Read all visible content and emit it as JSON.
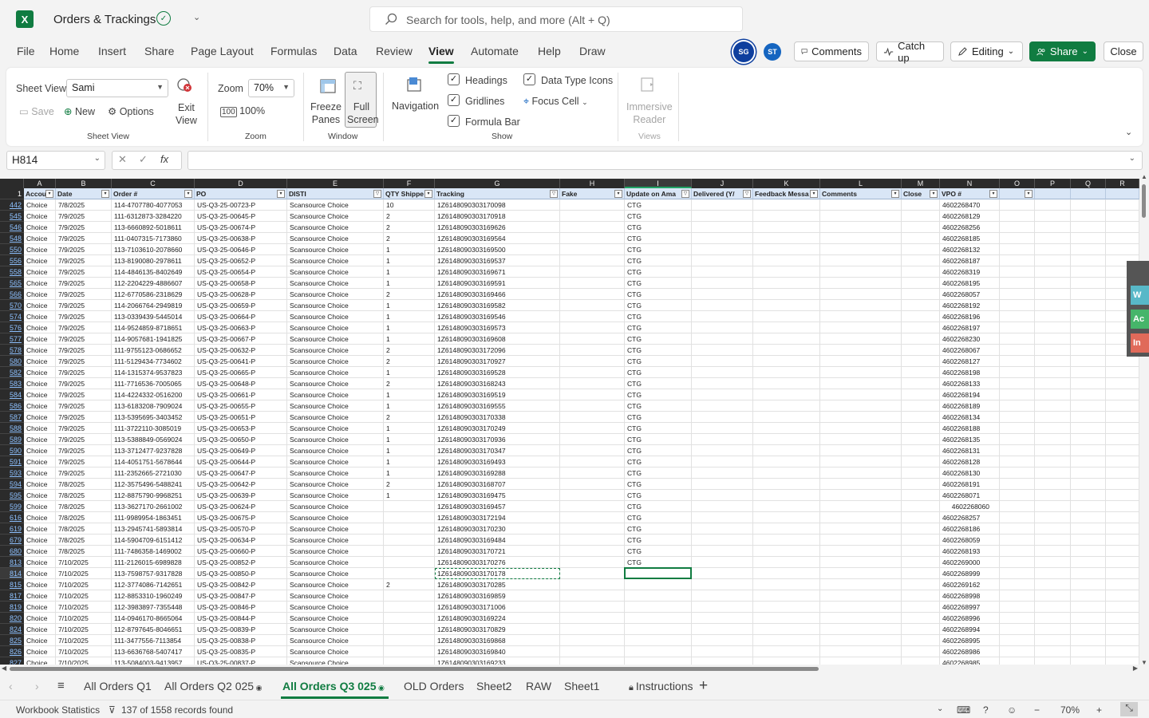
{
  "app": {
    "doc_title": "Orders & Trackings",
    "search_placeholder": "Search for tools, help, and more (Alt + Q)"
  },
  "menu": [
    "File",
    "Home",
    "Insert",
    "Share",
    "Page Layout",
    "Formulas",
    "Data",
    "Review",
    "View",
    "Automate",
    "Help",
    "Draw"
  ],
  "menu_active": "View",
  "users": {
    "sg": "SG",
    "st": "ST"
  },
  "top_buttons": {
    "comments": "Comments",
    "catchup": "Catch up",
    "editing": "Editing",
    "share": "Share",
    "close": "Close"
  },
  "ribbon": {
    "sheet_view_label": "Sheet View",
    "sheet_view_value": "Sami",
    "save": "Save",
    "new": "New",
    "options": "Options",
    "exit_view": "Exit\nView",
    "group_sheet_view": "Sheet View",
    "zoom_label": "Zoom",
    "zoom_value": "70%",
    "zoom_100": "100%",
    "group_zoom": "Zoom",
    "freeze_panes": "Freeze\nPanes",
    "full_screen": "Full\nScreen",
    "group_window": "Window",
    "navigation": "Navigation",
    "headings": "Headings",
    "gridlines": "Gridlines",
    "formula_bar": "Formula Bar",
    "data_type_icons": "Data Type Icons",
    "focus_cell": "Focus Cell",
    "group_show": "Show",
    "immersive_reader": "Immersive\nReader",
    "group_views": "Views"
  },
  "formula_bar": {
    "name_box": "H814",
    "value": ""
  },
  "columns": [
    {
      "letter": "A",
      "header": "Accou",
      "filter": false
    },
    {
      "letter": "B",
      "header": "Date",
      "filter": false
    },
    {
      "letter": "C",
      "header": "Order #",
      "filter": false
    },
    {
      "letter": "D",
      "header": "PO",
      "filter": false
    },
    {
      "letter": "E",
      "header": "DISTI",
      "filter": true
    },
    {
      "letter": "F",
      "header": "QTY Shippe",
      "filter": false
    },
    {
      "letter": "G",
      "header": "Tracking",
      "filter": true
    },
    {
      "letter": "H",
      "header": "Fake",
      "filter": false
    },
    {
      "letter": "I",
      "header": "Update on Ama",
      "filter": true
    },
    {
      "letter": "J",
      "header": "Delivered (Y/",
      "filter": true
    },
    {
      "letter": "K",
      "header": "Feedback Messa",
      "filter": false
    },
    {
      "letter": "L",
      "header": "Comments",
      "filter": false
    },
    {
      "letter": "M",
      "header": "Close",
      "filter": false
    },
    {
      "letter": "N",
      "header": "VPO #",
      "filter": false
    },
    {
      "letter": "O",
      "header": "",
      "filter": false
    },
    {
      "letter": "P",
      "header": "",
      "filter": false
    },
    {
      "letter": "Q",
      "header": "",
      "filter": false
    },
    {
      "letter": "R",
      "header": "",
      "filter": false
    }
  ],
  "header_row_number": "1",
  "rows": [
    [
      "442",
      "Choice",
      "7/8/2025",
      "114-4707780-4077053",
      "US-Q3-25-00723-P",
      "Scansource Choice",
      "10",
      "1Z6148090303170098",
      "",
      "CTG",
      "4602268470"
    ],
    [
      "545",
      "Choice",
      "7/9/2025",
      "111-6312873-3284220",
      "US-Q3-25-00645-P",
      "Scansource Choice",
      "2",
      "1Z6148090303170918",
      "",
      "CTG",
      "4602268129"
    ],
    [
      "546",
      "Choice",
      "7/9/2025",
      "113-6660892-5018611",
      "US-Q3-25-00674-P",
      "Scansource Choice",
      "2",
      "1Z6148090303169626",
      "",
      "CTG",
      "4602268256"
    ],
    [
      "548",
      "Choice",
      "7/9/2025",
      "111-0407315-7173860",
      "US-Q3-25-00638-P",
      "Scansource Choice",
      "2",
      "1Z6148090303169564",
      "",
      "CTG",
      "4602268185"
    ],
    [
      "550",
      "Choice",
      "7/9/2025",
      "113-7103610-2078660",
      "US-Q3-25-00646-P",
      "Scansource Choice",
      "1",
      "1Z6148090303169500",
      "",
      "CTG",
      "4602268132"
    ],
    [
      "556",
      "Choice",
      "7/9/2025",
      "113-8190080-2978611",
      "US-Q3-25-00652-P",
      "Scansource Choice",
      "1",
      "1Z6148090303169537",
      "",
      "CTG",
      "4602268187"
    ],
    [
      "558",
      "Choice",
      "7/9/2025",
      "114-4846135-8402649",
      "US-Q3-25-00654-P",
      "Scansource Choice",
      "1",
      "1Z6148090303169671",
      "",
      "CTG",
      "4602268319"
    ],
    [
      "565",
      "Choice",
      "7/9/2025",
      "112-2204229-4886607",
      "US-Q3-25-00658-P",
      "Scansource Choice",
      "1",
      "1Z6148090303169591",
      "",
      "CTG",
      "4602268195"
    ],
    [
      "566",
      "Choice",
      "7/9/2025",
      "112-6770586-2318629",
      "US-Q3-25-00628-P",
      "Scansource Choice",
      "2",
      "1Z6148090303169466",
      "",
      "CTG",
      "4602268057"
    ],
    [
      "570",
      "Choice",
      "7/9/2025",
      "114-2066764-2949819",
      "US-Q3-25-00659-P",
      "Scansource Choice",
      "1",
      "1Z6148090303169582",
      "",
      "CTG",
      "4602268192"
    ],
    [
      "574",
      "Choice",
      "7/9/2025",
      "113-0339439-5445014",
      "US-Q3-25-00664-P",
      "Scansource Choice",
      "1",
      "1Z6148090303169546",
      "",
      "CTG",
      "4602268196"
    ],
    [
      "576",
      "Choice",
      "7/9/2025",
      "114-9524859-8718651",
      "US-Q3-25-00663-P",
      "Scansource Choice",
      "1",
      "1Z6148090303169573",
      "",
      "CTG",
      "4602268197"
    ],
    [
      "577",
      "Choice",
      "7/9/2025",
      "114-9057681-1941825",
      "US-Q3-25-00667-P",
      "Scansource Choice",
      "1",
      "1Z6148090303169608",
      "",
      "CTG",
      "4602268230"
    ],
    [
      "578",
      "Choice",
      "7/9/2025",
      "111-9755123-0686652",
      "US-Q3-25-00632-P",
      "Scansource Choice",
      "2",
      "1Z6148090303172096",
      "",
      "CTG",
      "4602268067"
    ],
    [
      "580",
      "Choice",
      "7/9/2025",
      "111-5129434-7734602",
      "US-Q3-25-00641-P",
      "Scansource Choice",
      "2",
      "1Z6148090303170927",
      "",
      "CTG",
      "4602268127"
    ],
    [
      "582",
      "Choice",
      "7/9/2025",
      "114-1315374-9537823",
      "US-Q3-25-00665-P",
      "Scansource Choice",
      "1",
      "1Z6148090303169528",
      "",
      "CTG",
      "4602268198"
    ],
    [
      "583",
      "Choice",
      "7/9/2025",
      "111-7716536-7005065",
      "US-Q3-25-00648-P",
      "Scansource Choice",
      "2",
      "1Z6148090303168243",
      "",
      "CTG",
      "4602268133"
    ],
    [
      "584",
      "Choice",
      "7/9/2025",
      "114-4224332-0516200",
      "US-Q3-25-00661-P",
      "Scansource Choice",
      "1",
      "1Z6148090303169519",
      "",
      "CTG",
      "4602268194"
    ],
    [
      "586",
      "Choice",
      "7/9/2025",
      "113-6183208-7909024",
      "US-Q3-25-00655-P",
      "Scansource Choice",
      "1",
      "1Z6148090303169555",
      "",
      "CTG",
      "4602268189"
    ],
    [
      "587",
      "Choice",
      "7/9/2025",
      "113-5395695-3403452",
      "US-Q3-25-00651-P",
      "Scansource Choice",
      "2",
      "1Z6148090303170338",
      "",
      "CTG",
      "4602268134"
    ],
    [
      "588",
      "Choice",
      "7/9/2025",
      "111-3722110-3085019",
      "US-Q3-25-00653-P",
      "Scansource Choice",
      "1",
      "1Z6148090303170249",
      "",
      "CTG",
      "4602268188"
    ],
    [
      "589",
      "Choice",
      "7/9/2025",
      "113-5388849-0569024",
      "US-Q3-25-00650-P",
      "Scansource Choice",
      "1",
      "1Z6148090303170936",
      "",
      "CTG",
      "4602268135"
    ],
    [
      "590",
      "Choice",
      "7/9/2025",
      "113-3712477-9237828",
      "US-Q3-25-00649-P",
      "Scansource Choice",
      "1",
      "1Z6148090303170347",
      "",
      "CTG",
      "4602268131"
    ],
    [
      "591",
      "Choice",
      "7/9/2025",
      "114-4051751-5678644",
      "US-Q3-25-00644-P",
      "Scansource Choice",
      "1",
      "1Z6148090303169493",
      "",
      "CTG",
      "4602268128"
    ],
    [
      "593",
      "Choice",
      "7/9/2025",
      "111-2352665-2721030",
      "US-Q3-25-00647-P",
      "Scansource Choice",
      "1",
      "1Z6148090303169288",
      "",
      "CTG",
      "4602268130"
    ],
    [
      "594",
      "Choice",
      "7/8/2025",
      "112-3575496-5488241",
      "US-Q3-25-00642-P",
      "Scansource Choice",
      "2",
      "1Z6148090303168707",
      "",
      "CTG",
      "4602268191"
    ],
    [
      "595",
      "Choice",
      "7/8/2025",
      "112-8875790-9968251",
      "US-Q3-25-00639-P",
      "Scansource Choice",
      "1",
      "1Z6148090303169475",
      "",
      "CTG",
      "4602268071"
    ],
    [
      "599",
      "Choice",
      "7/8/2025",
      "113-3627170-2661002",
      "US-Q3-25-00624-P",
      "Scansource Choice",
      "",
      "1Z6148090303169457",
      "",
      "CTG",
      "4602268060"
    ],
    [
      "616",
      "Choice",
      "7/8/2025",
      "111-9989954-1863451",
      "US-Q3-25-00675-P",
      "Scansource Choice",
      "",
      "1Z6148090303172194",
      "",
      "CTG",
      "4602268257"
    ],
    [
      "619",
      "Choice",
      "7/8/2025",
      "113-2945741-5893814",
      "US-Q3-25-00570-P",
      "Scansource Choice",
      "",
      "1Z6148090303170230",
      "",
      "CTG",
      "4602268186"
    ],
    [
      "679",
      "Choice",
      "7/8/2025",
      "114-5904709-6151412",
      "US-Q3-25-00634-P",
      "Scansource Choice",
      "",
      "1Z6148090303169484",
      "",
      "CTG",
      "4602268059"
    ],
    [
      "680",
      "Choice",
      "7/8/2025",
      "111-7486358-1469002",
      "US-Q3-25-00660-P",
      "Scansource Choice",
      "",
      "1Z6148090303170721",
      "",
      "CTG",
      "4602268193"
    ],
    [
      "813",
      "Choice",
      "7/10/2025",
      "111-2126015-6989828",
      "US-Q3-25-00852-P",
      "Scansource Choice",
      "",
      "1Z6148090303170276",
      "",
      "CTG",
      "4602269000"
    ],
    [
      "814",
      "Choice",
      "7/10/2025",
      "113-7598757-9317828",
      "US-Q3-25-00850-P",
      "Scansource Choice",
      "",
      "1Z6148090303170178",
      "",
      "",
      "4602268999"
    ],
    [
      "815",
      "Choice",
      "7/10/2025",
      "112-3774086-7142651",
      "US-Q3-25-00842-P",
      "Scansource Choice",
      "2",
      "1Z6148090303170285",
      "",
      "",
      "4602269162"
    ],
    [
      "817",
      "Choice",
      "7/10/2025",
      "112-8853310-1960249",
      "US-Q3-25-00847-P",
      "Scansource Choice",
      "",
      "1Z6148090303169859",
      "",
      "",
      "4602268998"
    ],
    [
      "819",
      "Choice",
      "7/10/2025",
      "112-3983897-7355448",
      "US-Q3-25-00846-P",
      "Scansource Choice",
      "",
      "1Z6148090303171006",
      "",
      "",
      "4602268997"
    ],
    [
      "820",
      "Choice",
      "7/10/2025",
      "114-0946170-8665064",
      "US-Q3-25-00844-P",
      "Scansource Choice",
      "",
      "1Z6148090303169224",
      "",
      "",
      "4602268996"
    ],
    [
      "824",
      "Choice",
      "7/10/2025",
      "112-8797645-8046651",
      "US-Q3-25-00839-P",
      "Scansource Choice",
      "",
      "1Z6148090303170829",
      "",
      "",
      "4602268994"
    ],
    [
      "825",
      "Choice",
      "7/10/2025",
      "111-3477556-7113854",
      "US-Q3-25-00838-P",
      "Scansource Choice",
      "",
      "1Z6148090303169868",
      "",
      "",
      "4602268995"
    ],
    [
      "826",
      "Choice",
      "7/10/2025",
      "113-6636768-5407417",
      "US-Q3-25-00835-P",
      "Scansource Choice",
      "",
      "1Z6148090303169840",
      "",
      "",
      "4602268986"
    ],
    [
      "827",
      "Choice",
      "7/10/2025",
      "113-5084003-9413957",
      "US-Q3-25-00837-P",
      "Scansource Choice",
      "",
      "1Z6148090303169233",
      "",
      "",
      "4602268985"
    ]
  ],
  "side_tabs": [
    "W",
    "Ac",
    "In"
  ],
  "side_tab_colors": [
    "#58b8c8",
    "#46b56a",
    "#e06a5a"
  ],
  "sheet_tabs": [
    "All Orders Q1",
    "All Orders Q2 025",
    "All Orders Q3 025",
    "OLD Orders",
    "Sheet2",
    "RAW",
    "Sheet1",
    "Instructions"
  ],
  "active_sheet": "All Orders Q3 025",
  "status": {
    "workbook_stats": "Workbook Statistics",
    "records": "137 of 1558 records found",
    "zoom": "70%"
  },
  "colors": {
    "accent": "#107c41",
    "header_fill": "#d9e6f6"
  }
}
